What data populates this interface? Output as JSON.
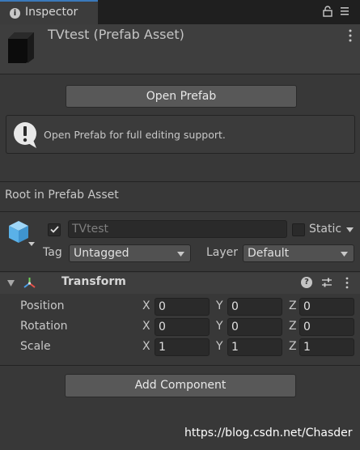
{
  "tab": {
    "label": "Inspector",
    "icon": "info-icon"
  },
  "header": {
    "title": "TVtest (Prefab Asset)"
  },
  "open_prefab_button": "Open Prefab",
  "help_box": {
    "text": "Open Prefab for full editing support.",
    "icon": "warning-icon"
  },
  "section_label": "Root in Prefab Asset",
  "game_object": {
    "active": true,
    "name": "TVtest",
    "static_label": "Static",
    "static": false,
    "tag_label": "Tag",
    "tag_value": "Untagged",
    "layer_label": "Layer",
    "layer_value": "Default"
  },
  "transform": {
    "title": "Transform",
    "rows": [
      {
        "label": "Position",
        "x": "0",
        "y": "0",
        "z": "0"
      },
      {
        "label": "Rotation",
        "x": "0",
        "y": "0",
        "z": "0"
      },
      {
        "label": "Scale",
        "x": "1",
        "y": "1",
        "z": "1"
      }
    ],
    "axis_labels": {
      "x": "X",
      "y": "Y",
      "z": "Z"
    }
  },
  "add_component_button": "Add Component",
  "watermark": "https://blog.csdn.net/Chasder",
  "colors": {
    "tab_accent": "#3a79bb",
    "panel_bg": "#383838",
    "cube": "#5ab1e8"
  }
}
